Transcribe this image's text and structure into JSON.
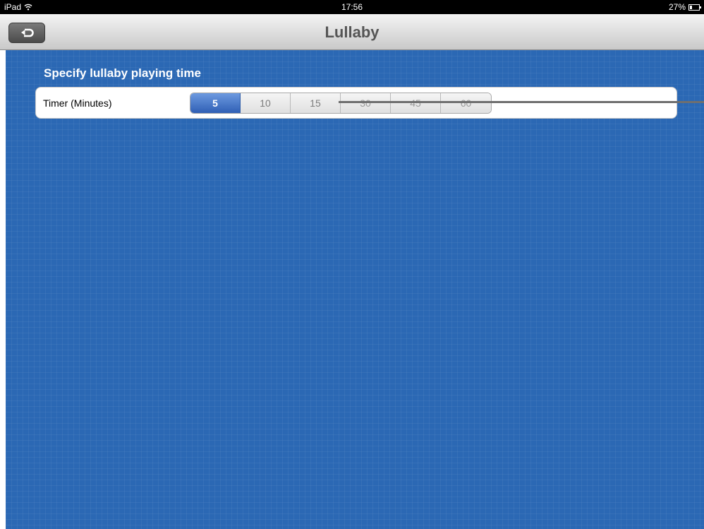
{
  "status_bar": {
    "device": "iPad",
    "time": "17:56",
    "battery": "27%",
    "battery_level": 0.27
  },
  "nav": {
    "title": "Lullaby",
    "back_icon": "back-arrow-icon"
  },
  "content": {
    "section_title": "Specify lullaby playing time",
    "timer_label": "Timer (Minutes)",
    "options": [
      "5",
      "10",
      "15",
      "30",
      "45",
      "60"
    ],
    "selected": "5"
  },
  "colors": {
    "background": "#2b68b4",
    "selected_segment": "#3c6dc0"
  }
}
